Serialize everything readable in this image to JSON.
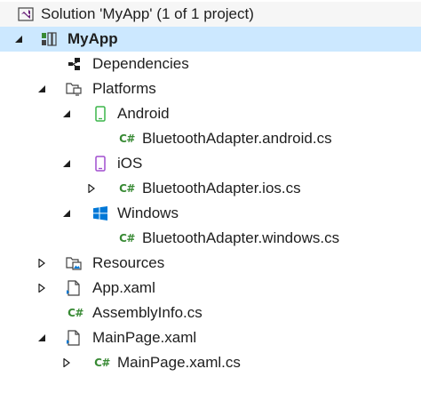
{
  "solution": {
    "label": "Solution 'MyApp' (1 of 1 project)",
    "icon": "vs-solution-icon"
  },
  "project": {
    "label": "MyApp",
    "icon": "csharp-project-icon",
    "expanded": true,
    "selected": true
  },
  "nodes": {
    "dependencies": {
      "label": "Dependencies",
      "icon": "dependencies-icon"
    },
    "platforms": {
      "label": "Platforms",
      "icon": "platforms-folder-icon",
      "expanded": true
    },
    "android": {
      "label": "Android",
      "icon": "android-phone-icon",
      "expanded": true
    },
    "android_adapter": {
      "label": "BluetoothAdapter.android.cs",
      "icon": "csharp-file-icon",
      "badge": "C#"
    },
    "ios": {
      "label": "iOS",
      "icon": "ios-phone-icon",
      "expanded": true
    },
    "ios_adapter": {
      "label": "BluetoothAdapter.ios.cs",
      "icon": "csharp-file-icon",
      "badge": "C#",
      "expanded": false
    },
    "windows": {
      "label": "Windows",
      "icon": "windows-logo-icon",
      "expanded": true
    },
    "windows_adapter": {
      "label": "BluetoothAdapter.windows.cs",
      "icon": "csharp-file-icon",
      "badge": "C#"
    },
    "resources": {
      "label": "Resources",
      "icon": "resources-folder-icon",
      "expanded": false
    },
    "app_xaml": {
      "label": "App.xaml",
      "icon": "xaml-file-icon",
      "expanded": false
    },
    "assembly_info": {
      "label": "AssemblyInfo.cs",
      "icon": "csharp-file-icon",
      "badge": "C#"
    },
    "main_page_xaml": {
      "label": "MainPage.xaml",
      "icon": "xaml-file-icon",
      "expanded": true
    },
    "main_page_cs": {
      "label": "MainPage.xaml.cs",
      "icon": "csharp-file-icon",
      "badge": "C#",
      "expanded": false
    }
  },
  "colors": {
    "selection": "#cce8ff",
    "vs_purple": "#68217a",
    "csharp_green": "#388a34",
    "android_green": "#3bb54a",
    "ios_purple": "#a14ecf",
    "windows_blue": "#0078d7",
    "folder_gray": "#424242"
  }
}
